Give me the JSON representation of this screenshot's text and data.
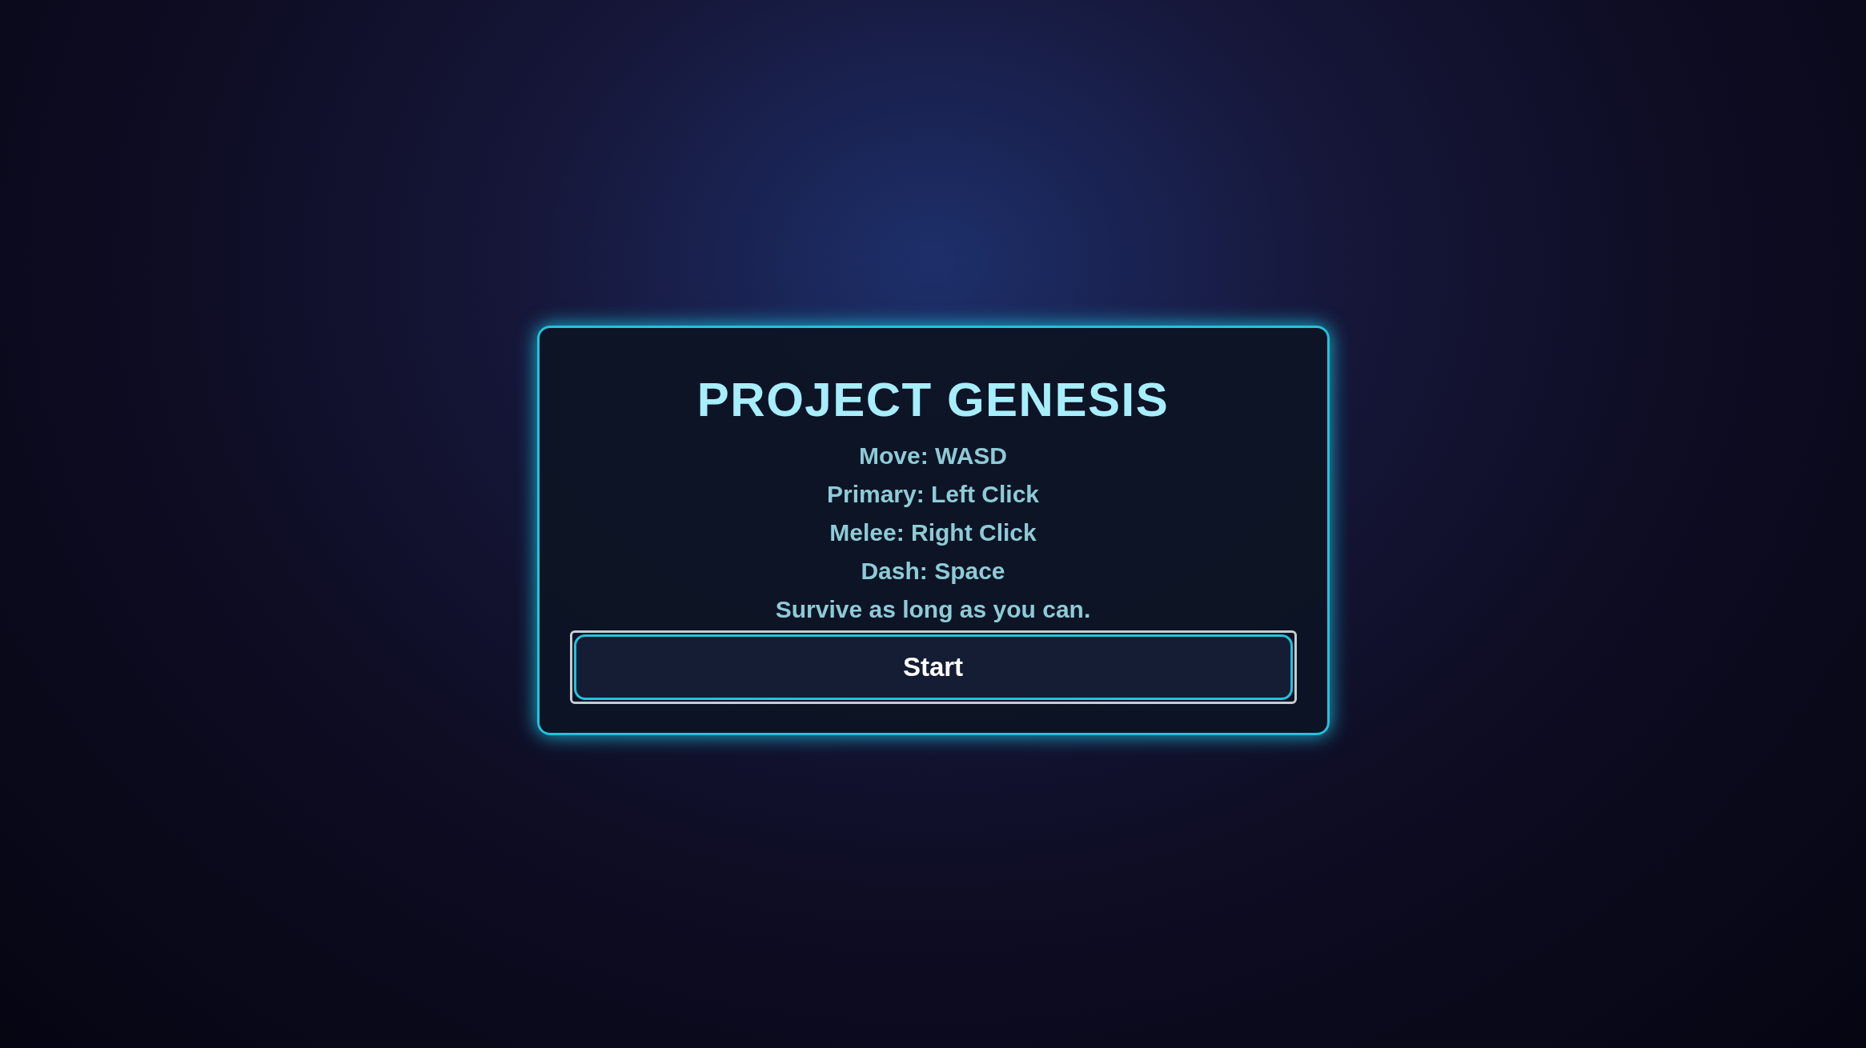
{
  "title": "PROJECT GENESIS",
  "instructions": [
    "Move: WASD",
    "Primary: Left Click",
    "Melee: Right Click",
    "Dash: Space",
    "Survive as long as you can."
  ],
  "start_button": {
    "label": "Start"
  }
}
